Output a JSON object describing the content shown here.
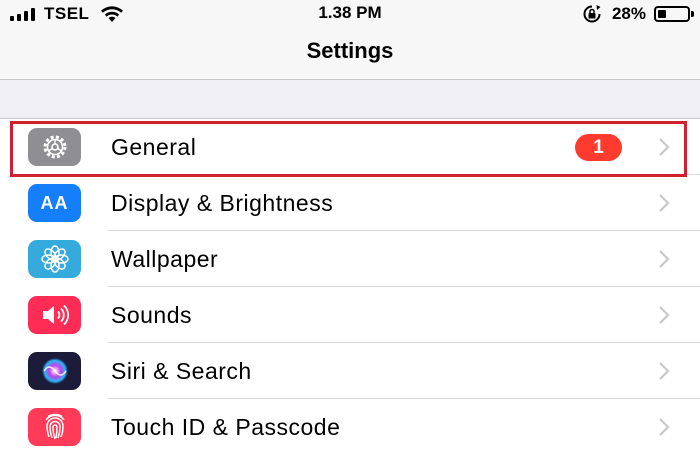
{
  "status_bar": {
    "carrier": "TSEL",
    "time": "1.38 PM",
    "battery_percent": "28%",
    "battery_level": 0.28,
    "icons": [
      "signal-icon",
      "wifi-icon",
      "rotation-lock-icon",
      "battery-icon"
    ]
  },
  "nav": {
    "title": "Settings"
  },
  "rows": [
    {
      "label": "General",
      "badge": "1",
      "icon": "gear-icon",
      "icon_color": "#8e8e93",
      "highlighted": true
    },
    {
      "label": "Display & Brightness",
      "icon_text": "AA",
      "icon": "display-brightness-icon",
      "icon_color": "#147efb"
    },
    {
      "label": "Wallpaper",
      "icon": "wallpaper-flower-icon",
      "icon_color": "#35aadc"
    },
    {
      "label": "Sounds",
      "icon": "speaker-icon",
      "icon_color": "#ff2d55"
    },
    {
      "label": "Siri & Search",
      "icon": "siri-icon",
      "icon_color": "#1c1c3a"
    },
    {
      "label": "Touch ID & Passcode",
      "icon": "fingerprint-icon",
      "icon_color": "#ff3b58"
    }
  ],
  "colors": {
    "highlight_border": "#d01f2e",
    "badge": "#ff3b30",
    "background": "#efeff4"
  }
}
